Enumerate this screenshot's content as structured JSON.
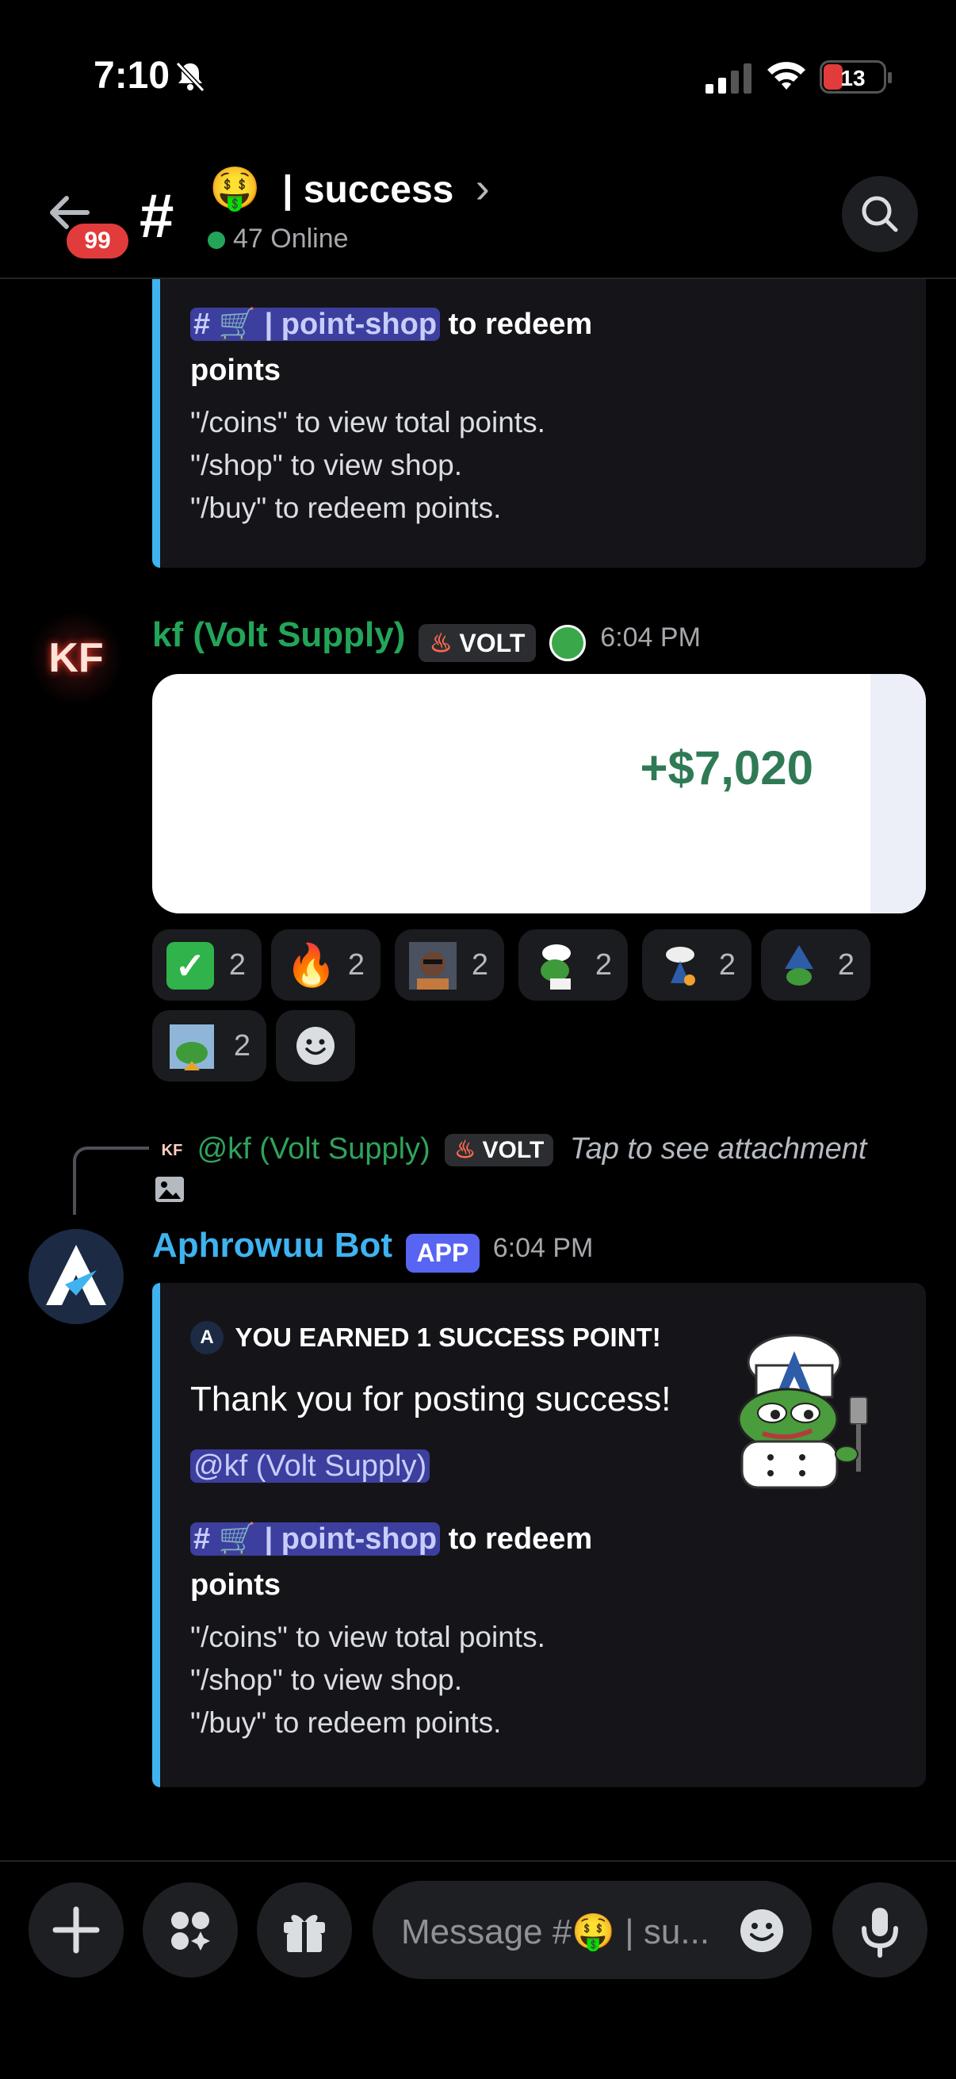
{
  "status_bar": {
    "time": "7:10",
    "battery": "13"
  },
  "header": {
    "unread_badge": "99",
    "channel_emoji": "🤑",
    "channel_name": "| success",
    "chevron": "›",
    "online_text": "47 Online"
  },
  "top_embed": {
    "channel_mention": "# 🛒 | point-shop",
    "redeem_text_1": "to redeem",
    "redeem_text_2": "points",
    "cmd_1": "\"/coins\" to view total points.",
    "cmd_2": "\"/shop\" to view shop.",
    "cmd_3": "\"/buy\" to redeem points."
  },
  "message_kf": {
    "avatar_text": "KF",
    "author": "kf (Volt Supply)",
    "tag": "VOLT",
    "time": "6:04 PM",
    "image_amount": "+$7,020",
    "reactions": [
      {
        "emoji": "✅",
        "count": "2"
      },
      {
        "emoji": "🔥",
        "count": "2"
      },
      {
        "emoji": "face",
        "count": "2"
      },
      {
        "emoji": "chef-frog",
        "count": "2"
      },
      {
        "emoji": "chef-a",
        "count": "2"
      },
      {
        "emoji": "frog-a",
        "count": "2"
      },
      {
        "emoji": "frog-sign",
        "count": "2"
      }
    ]
  },
  "reply": {
    "author_mention": "@kf (Volt Supply)",
    "tag": "VOLT",
    "attachment_text": "Tap to see attachment"
  },
  "message_bot": {
    "author": "Aphrowuu Bot",
    "app_badge": "APP",
    "time": "6:04 PM",
    "embed_author": "YOU EARNED 1 SUCCESS POINT!",
    "thank_you": "Thank you for posting success!",
    "user_mention": "@kf (Volt Supply)",
    "channel_mention": "# 🛒 | point-shop",
    "redeem_text_1": "to redeem",
    "redeem_text_2": "points",
    "cmd_1": "\"/coins\" to view total points.",
    "cmd_2": "\"/shop\" to view shop.",
    "cmd_3": "\"/buy\" to redeem points."
  },
  "composer": {
    "placeholder": "Message #🤑 | su..."
  },
  "colors": {
    "accent_blue": "#3fb3f0",
    "green": "#23a559",
    "badge_red": "#e23b3b",
    "app_badge": "#5865f2"
  }
}
